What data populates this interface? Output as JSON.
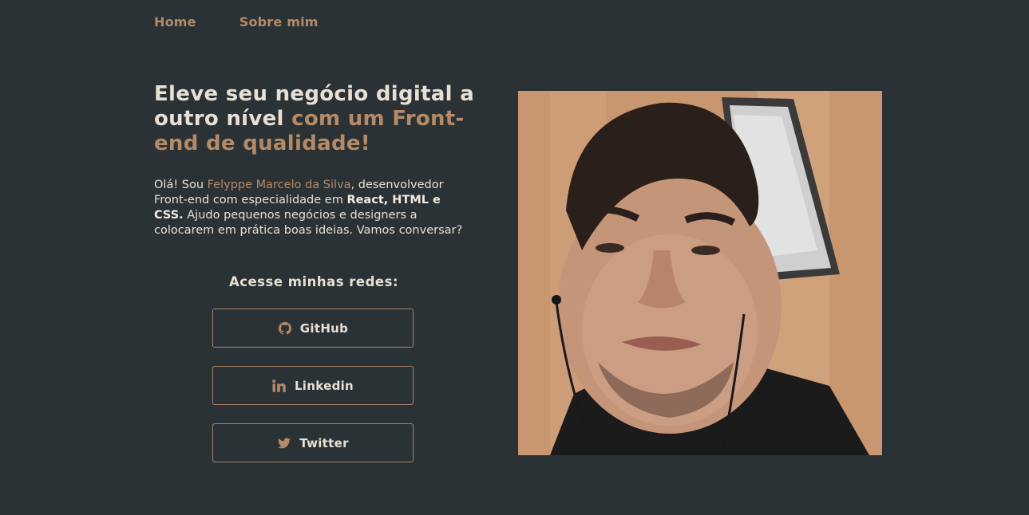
{
  "nav": {
    "home": "Home",
    "about": "Sobre mim"
  },
  "hero": {
    "headline_part1": "Eleve seu negócio digital a outro nível",
    "headline_part2": "com um Front-end de qualidade!",
    "intro_prefix": "Olá! Sou",
    "name": "Felyppe Marcelo da Silva",
    "intro_mid": ", desenvolvedor Front-end com especialidade em",
    "skills": "React, HTML e CSS.",
    "intro_suffix": "Ajudo pequenos negócios e designers a colocarem em prática boas ideias. Vamos conversar?"
  },
  "social": {
    "title": "Acesse minhas redes:",
    "buttons": [
      {
        "label": "GitHub",
        "icon": "github-icon"
      },
      {
        "label": "Linkedin",
        "icon": "linkedin-icon"
      },
      {
        "label": "Twitter",
        "icon": "twitter-icon"
      }
    ]
  },
  "colors": {
    "background": "#2b3235",
    "accent": "#b48a68",
    "text": "#e8e0d4"
  }
}
